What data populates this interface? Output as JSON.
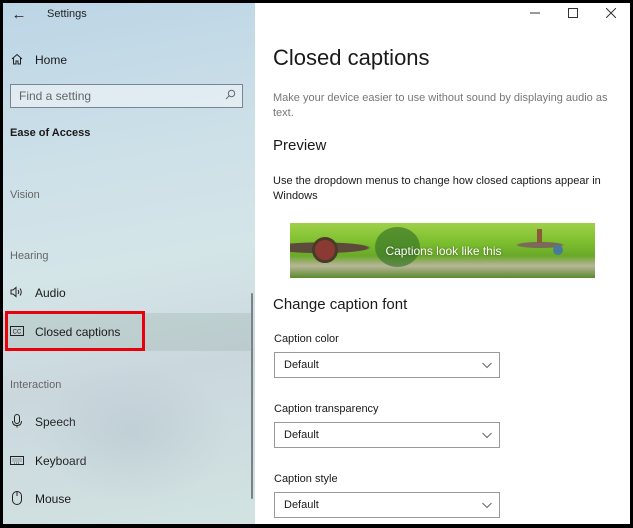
{
  "window": {
    "title": "Settings",
    "controls": {
      "minimize": "—",
      "maximize": "☐",
      "close": "✕"
    }
  },
  "sidebar": {
    "back_icon": "←",
    "home": {
      "icon": "home-icon",
      "glyph": "⌂",
      "label": "Home"
    },
    "search": {
      "placeholder": "Find a setting",
      "value": "",
      "icon": "⌕"
    },
    "section": "Ease of Access",
    "groups": [
      {
        "label": "Vision",
        "items": []
      },
      {
        "label": "Hearing",
        "items": [
          {
            "label": "Audio",
            "icon": "speaker-icon",
            "glyph": "🔈",
            "selected": false
          },
          {
            "label": "Closed captions",
            "icon": "closed-captions-icon",
            "glyph": "CC",
            "selected": true
          }
        ]
      },
      {
        "label": "Interaction",
        "items": [
          {
            "label": "Speech",
            "icon": "microphone-icon",
            "glyph": "🎙",
            "selected": false
          },
          {
            "label": "Keyboard",
            "icon": "keyboard-icon",
            "glyph": "⌨",
            "selected": false
          },
          {
            "label": "Mouse",
            "icon": "mouse-icon",
            "glyph": "🖱",
            "selected": false
          }
        ]
      }
    ]
  },
  "main": {
    "title": "Closed captions",
    "description": "Make your device easier to use without sound by displaying audio as text.",
    "preview": {
      "heading": "Preview",
      "instructions": "Use the dropdown menus to change how closed captions appear in Windows",
      "caption_text": "Captions look like this"
    },
    "font_section": {
      "heading": "Change caption font",
      "fields": [
        {
          "label": "Caption color",
          "value": "Default"
        },
        {
          "label": "Caption transparency",
          "value": "Default"
        },
        {
          "label": "Caption style",
          "value": "Default"
        }
      ]
    }
  },
  "colors": {
    "highlight_box": "#e8000b",
    "content_bg": "#ffffff"
  }
}
